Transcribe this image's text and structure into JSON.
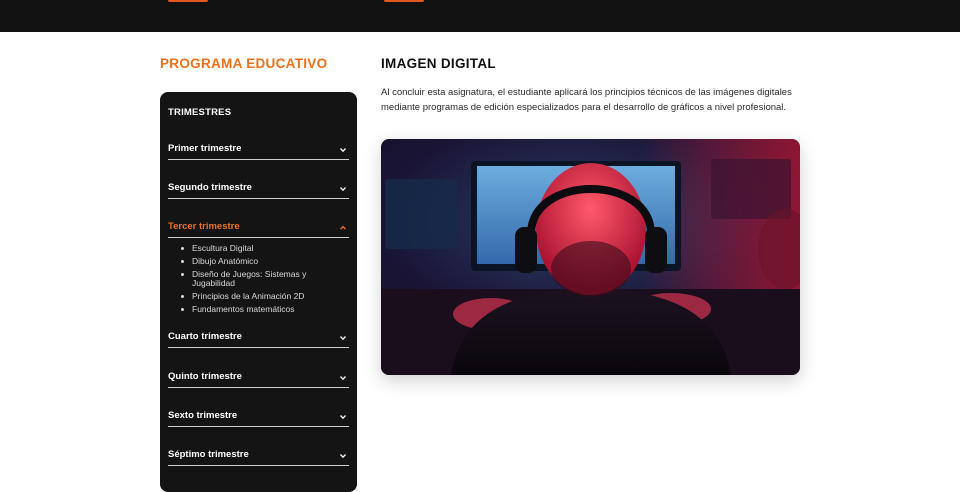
{
  "sidebar": {
    "title": "PROGRAMA EDUCATIVO",
    "heading": "TRIMESTRES",
    "items": [
      {
        "label": "Primer trimestre",
        "open": false
      },
      {
        "label": "Segundo trimestre",
        "open": false
      },
      {
        "label": "Tercer trimestre",
        "open": true
      },
      {
        "label": "Cuarto trimestre",
        "open": false
      },
      {
        "label": "Quinto trimestre",
        "open": false
      },
      {
        "label": "Sexto trimestre",
        "open": false
      },
      {
        "label": "Séptimo trimestre",
        "open": false
      }
    ],
    "open_subjects": [
      "Escultura Digital",
      "Dibujo Anatómico",
      "Diseño de Juegos: Sistemas y Jugabilidad",
      "Principios de la Animación 2D",
      "Fundamentos matemáticos"
    ]
  },
  "main": {
    "title": "IMAGEN DIGITAL",
    "description": "Al concluir esta asignatura, el estudiante aplicará los principios técnicos de las imágenes digitales mediante programas de edición especializados para el desarrollo de gráficos a nivel profesional."
  },
  "colors": {
    "accent": "#f07017",
    "panel": "#141414",
    "topbar": "#121212"
  },
  "icons": {
    "collapsed": "chevron-down-icon",
    "expanded": "chevron-up-icon"
  }
}
